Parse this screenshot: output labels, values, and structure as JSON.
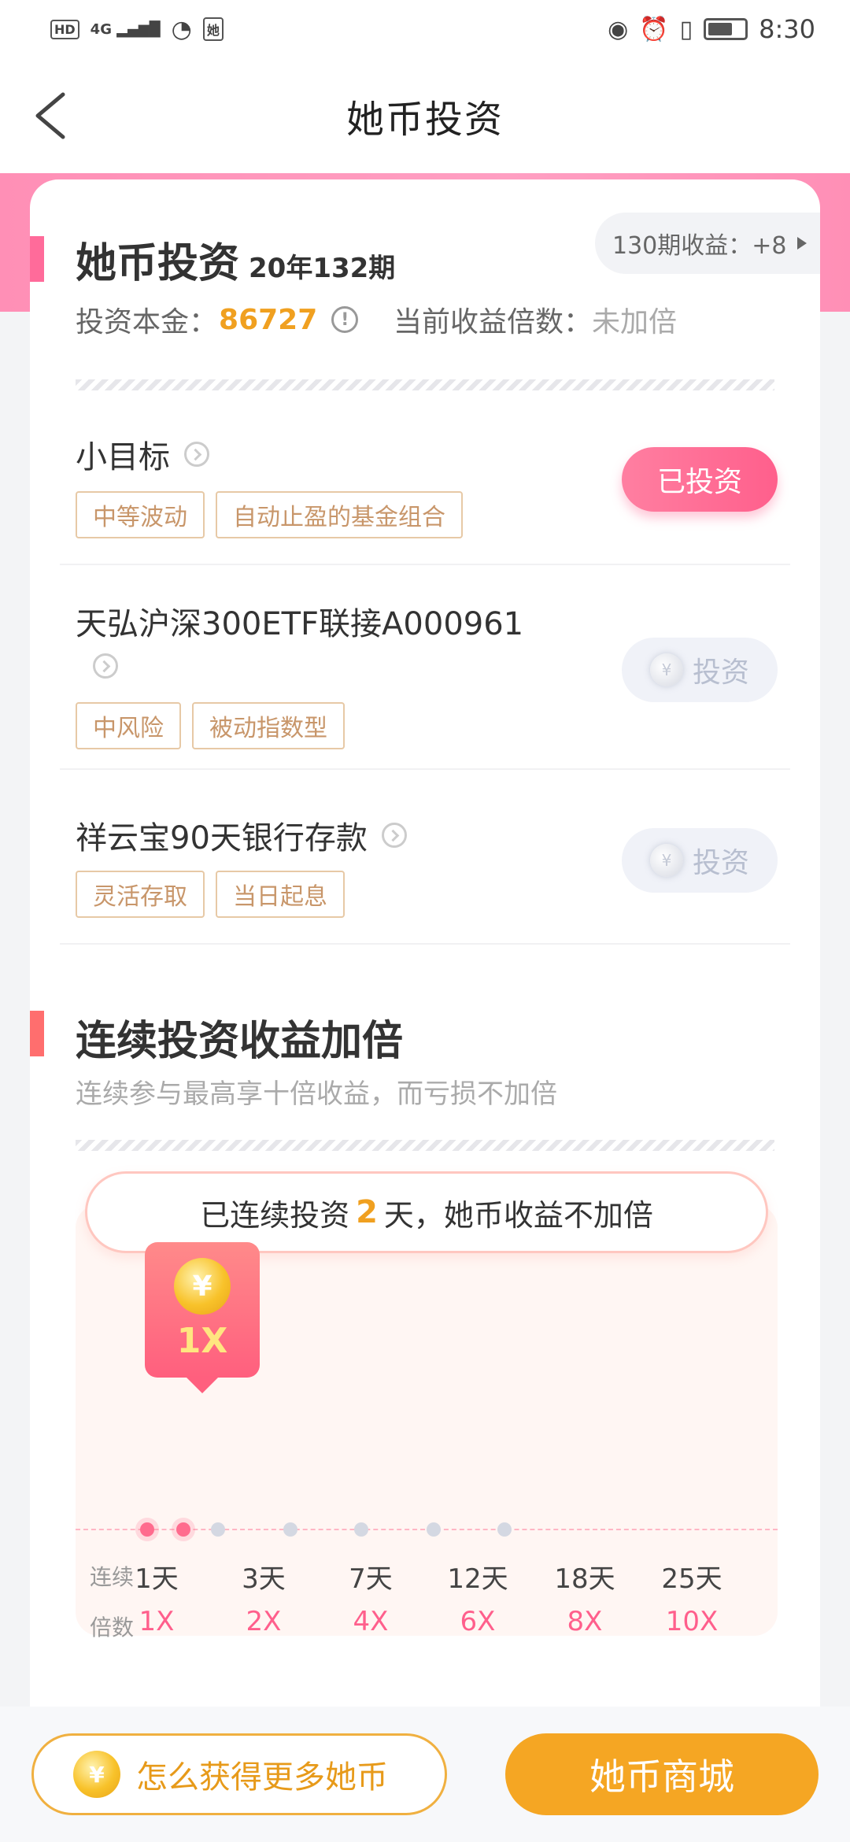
{
  "status_bar": {
    "chips": [
      "HD",
      "4G"
    ],
    "app_chip": "她",
    "time": "8:30"
  },
  "header": {
    "title": "她币投资"
  },
  "invest_card": {
    "title": "她币投资",
    "period": "20年132期",
    "earnings_pill": "130期收益：+8",
    "principal_label": "投资本金：",
    "principal_value": "86727",
    "multiplier_label": "当前收益倍数：",
    "multiplier_value": "未加倍"
  },
  "products": [
    {
      "name": "小目标",
      "tags": [
        "中等波动",
        "自动止盈的基金组合"
      ],
      "button": "已投资",
      "state": "invested"
    },
    {
      "name": "天弘沪深300ETF联接A000961",
      "tags": [
        "中风险",
        "被动指数型"
      ],
      "button": "投资",
      "state": "available"
    },
    {
      "name": "祥云宝90天银行存款",
      "tags": [
        "灵活存取",
        "当日起息"
      ],
      "button": "投资",
      "state": "available"
    }
  ],
  "streak": {
    "title": "连续投资收益加倍",
    "desc": "连续参与最高享十倍收益，而亏损不加倍",
    "pill_prefix": "已连续投资",
    "pill_days": "2",
    "pill_suffix": "天，她币收益不加倍",
    "badge_multiplier": "1X",
    "row_label_days": "连续",
    "row_label_mult": "倍数",
    "days": [
      "1天",
      "3天",
      "7天",
      "12天",
      "18天",
      "25天"
    ],
    "multipliers": [
      "1X",
      "2X",
      "4X",
      "6X",
      "8X",
      "10X"
    ],
    "active_dots": 2
  },
  "bottom": {
    "how_label": "怎么获得更多她币",
    "store_label": "她币商城"
  },
  "colors": {
    "accent_pink": "#ff5f8c",
    "accent_gold": "#f5a623",
    "tag_text": "#c8966a"
  },
  "icons": {
    "back": "back-icon",
    "info": "info-icon",
    "chevron": "chevron-right-circle-icon",
    "coin": "yuan-coin-icon"
  },
  "currency_symbol": "¥"
}
